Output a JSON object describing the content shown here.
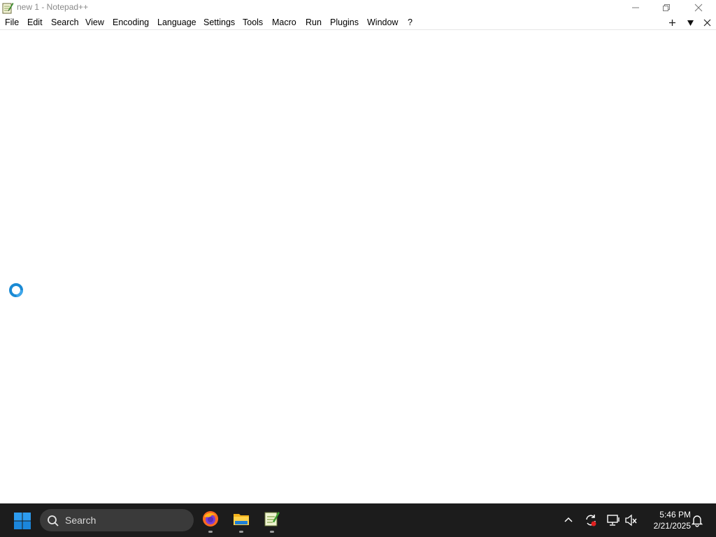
{
  "window": {
    "title": "new 1 - Notepad++"
  },
  "menu": {
    "items": [
      {
        "label": "File"
      },
      {
        "label": "Edit"
      },
      {
        "label": "Search"
      },
      {
        "label": "View"
      },
      {
        "label": "Encoding"
      },
      {
        "label": "Language"
      },
      {
        "label": "Settings"
      },
      {
        "label": "Tools"
      },
      {
        "label": "Macro"
      },
      {
        "label": "Run"
      },
      {
        "label": "Plugins"
      },
      {
        "label": "Window"
      },
      {
        "label": "?"
      }
    ],
    "right_icons": [
      "plus-icon",
      "dropdown-arrow-icon",
      "close-icon"
    ]
  },
  "editor": {
    "content": "",
    "cursor": "busy-cursor-icon"
  },
  "taskbar": {
    "search_placeholder": "Search",
    "apps": [
      {
        "icon": "firefox-icon"
      },
      {
        "icon": "file-explorer-icon"
      },
      {
        "icon": "notepadpp-icon"
      }
    ],
    "tray_icons": [
      "chevron-up-icon",
      "sync-icon",
      "network-icon",
      "volume-muted-icon",
      "bell-icon"
    ],
    "clock": {
      "time": "5:46 PM",
      "date": "2/21/2025"
    }
  },
  "colors": {
    "taskbar_bg": "#1c1c1c",
    "accent_blue": "#0078d4",
    "busy_cursor": "#1a8ad4"
  }
}
